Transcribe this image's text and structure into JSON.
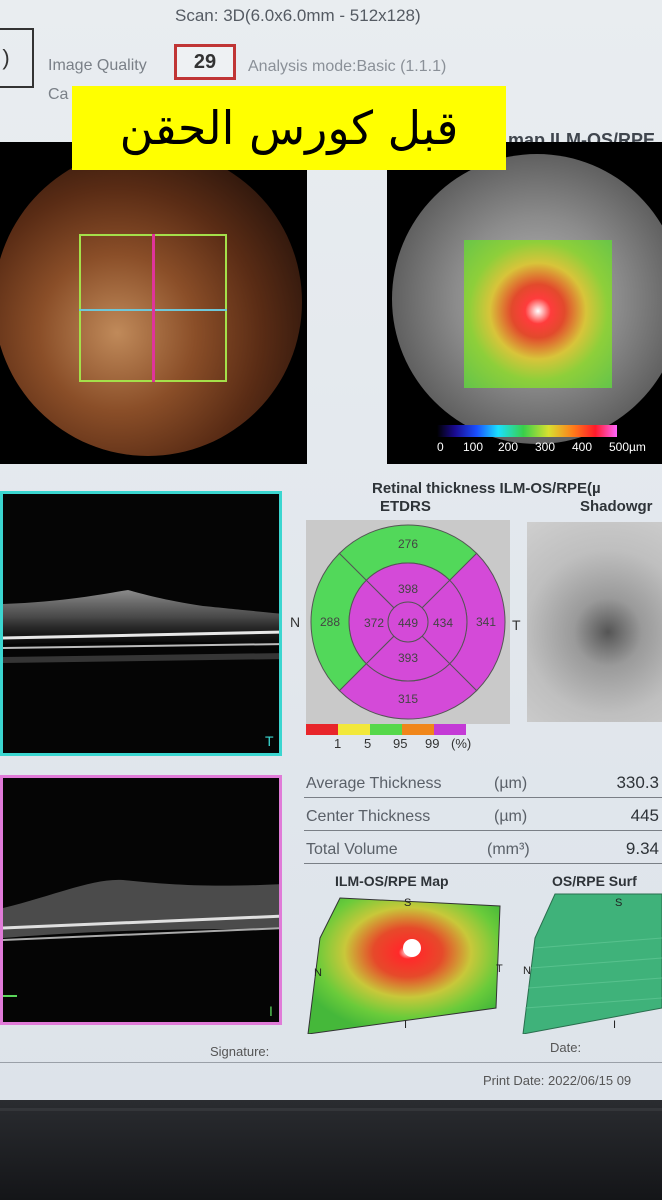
{
  "header": {
    "scan": "Scan: 3D(6.0x6.0mm - 512x128)",
    "image_quality_label": "Image Quality",
    "image_quality_value": "29",
    "capture_label": "Ca",
    "analysis_mode": "Analysis mode:Basic (1.1.1)",
    "left_box": ")"
  },
  "banner": {
    "text": "قبل كورس الحقن",
    "color": "#ffff00"
  },
  "map_title": "map ILM-OS/RPE",
  "colorbar": {
    "labels": [
      "0",
      "100",
      "200",
      "300",
      "400",
      "500µm"
    ]
  },
  "retinal": {
    "title": "Retinal thickness ILM-OS/RPE(µ",
    "etdrs_label": "ETDRS",
    "shadowgram_label": "Shadowgr",
    "side_n": "N",
    "side_t": "T",
    "sectors": {
      "outer_superior": "276",
      "outer_nasal": "288",
      "outer_temporal": "341",
      "outer_inferior": "315",
      "inner_superior": "398",
      "inner_nasal": "372",
      "inner_temporal": "434",
      "inner_inferior": "393",
      "center": "449"
    },
    "colors": {
      "green": "#52d85a",
      "magenta": "#d44ad8"
    },
    "legend": [
      "1",
      "5",
      "95",
      "99",
      "(%)"
    ]
  },
  "oct": {
    "marker1": "T",
    "marker2": "I"
  },
  "stats": [
    {
      "label": "Average Thickness",
      "unit": "(µm)",
      "value": "330.3"
    },
    {
      "label": "Center Thickness",
      "unit": "(µm)",
      "value": "445"
    },
    {
      "label": "Total Volume",
      "unit": "(mm³)",
      "value": "9.34"
    }
  ],
  "maps3d": {
    "ilm_title": "ILM-OS/RPE Map",
    "os_title": "OS/RPE Surf",
    "s": "S",
    "n": "N",
    "t": "T",
    "i": "I"
  },
  "footer": {
    "signature": "Signature:",
    "date": "Date:",
    "print_date": "Print Date: 2022/06/15 09"
  }
}
